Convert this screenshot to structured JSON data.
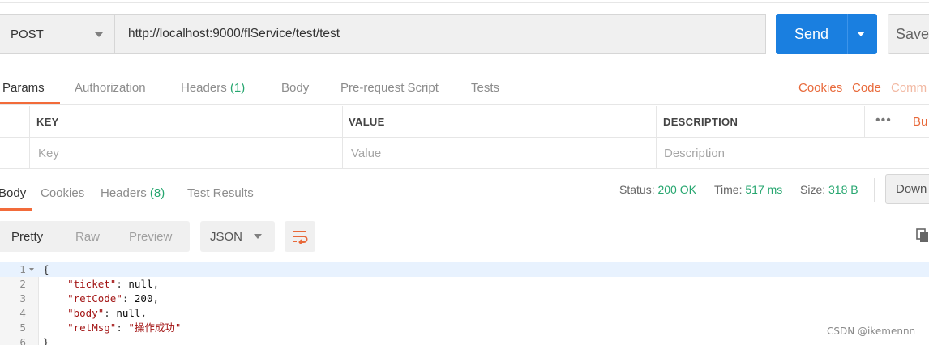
{
  "request": {
    "method": "POST",
    "url": "http://localhost:9000/flService/test/test",
    "send_label": "Send",
    "save_label": "Save"
  },
  "request_tabs": [
    {
      "label": "Params",
      "active": true
    },
    {
      "label": "Authorization"
    },
    {
      "label": "Headers",
      "count": "(1)"
    },
    {
      "label": "Body"
    },
    {
      "label": "Pre-request Script"
    },
    {
      "label": "Tests"
    }
  ],
  "right_links": {
    "cookies": "Cookies",
    "code": "Code",
    "comments": "Comm"
  },
  "params_table": {
    "headers": {
      "key": "KEY",
      "value": "VALUE",
      "description": "DESCRIPTION"
    },
    "placeholders": {
      "key": "Key",
      "value": "Value",
      "description": "Description"
    },
    "more": "•••",
    "bulk_edit": "Bu"
  },
  "response_tabs": [
    {
      "label": "Body",
      "active": true
    },
    {
      "label": "Cookies"
    },
    {
      "label": "Headers",
      "count": "(8)"
    },
    {
      "label": "Test Results"
    }
  ],
  "response_meta": {
    "status_label": "Status:",
    "status": "200 OK",
    "time_label": "Time:",
    "time": "517 ms",
    "size_label": "Size:",
    "size": "318 B",
    "download_label": "Down"
  },
  "view": {
    "modes": [
      "Pretty",
      "Raw",
      "Preview"
    ],
    "active_mode": "Pretty",
    "format": "JSON"
  },
  "code_lines": [
    {
      "n": "1",
      "text": "{"
    },
    {
      "n": "2",
      "key": "\"ticket\"",
      "sep": ": ",
      "val": "null",
      "tail": ","
    },
    {
      "n": "3",
      "key": "\"retCode\"",
      "sep": ": ",
      "val": "200",
      "tail": ","
    },
    {
      "n": "4",
      "key": "\"body\"",
      "sep": ": ",
      "val": "null",
      "tail": ","
    },
    {
      "n": "5",
      "key": "\"retMsg\"",
      "sep": ": ",
      "val": "\"操作成功\"",
      "tail": ""
    },
    {
      "n": "6",
      "text": "}"
    }
  ],
  "watermark": "CSDN @ikemennn",
  "colors": {
    "accent": "#f26b3a",
    "primary": "#1a7fe0",
    "success": "#26a66f"
  }
}
